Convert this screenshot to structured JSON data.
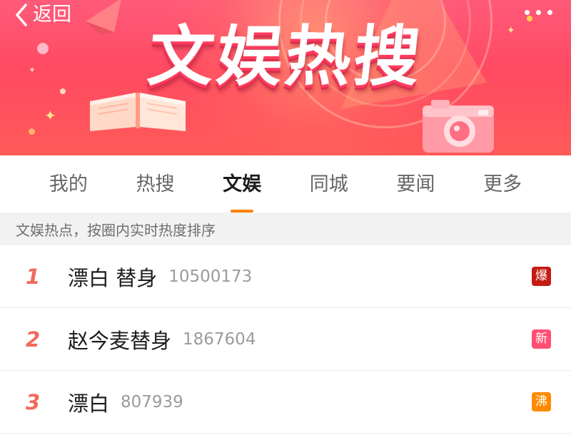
{
  "header": {
    "back_label": "返回",
    "title": "文娱热搜"
  },
  "tabs": [
    {
      "label": "我的",
      "active": false
    },
    {
      "label": "热搜",
      "active": false
    },
    {
      "label": "文娱",
      "active": true
    },
    {
      "label": "同城",
      "active": false
    },
    {
      "label": "要闻",
      "active": false
    },
    {
      "label": "更多",
      "active": false
    }
  ],
  "info_bar": {
    "text": "文娱热点，按圈内实时热度排序"
  },
  "list": [
    {
      "rank": "1",
      "topic": "漂白 替身",
      "count": "10500173",
      "badge": "爆",
      "badge_color": "#c41b12"
    },
    {
      "rank": "2",
      "topic": "赵今麦替身",
      "count": "1867604",
      "badge": "新",
      "badge_color": "#ff4f73"
    },
    {
      "rank": "3",
      "topic": "漂白",
      "count": "807939",
      "badge": "沸",
      "badge_color": "#ff8a00"
    }
  ],
  "colors": {
    "accent": "#ff8200",
    "rank": "#f26a5c",
    "banner": "#ff4a62"
  },
  "icons": {
    "back": "chevron-left-icon",
    "more": "more-dots-icon"
  }
}
